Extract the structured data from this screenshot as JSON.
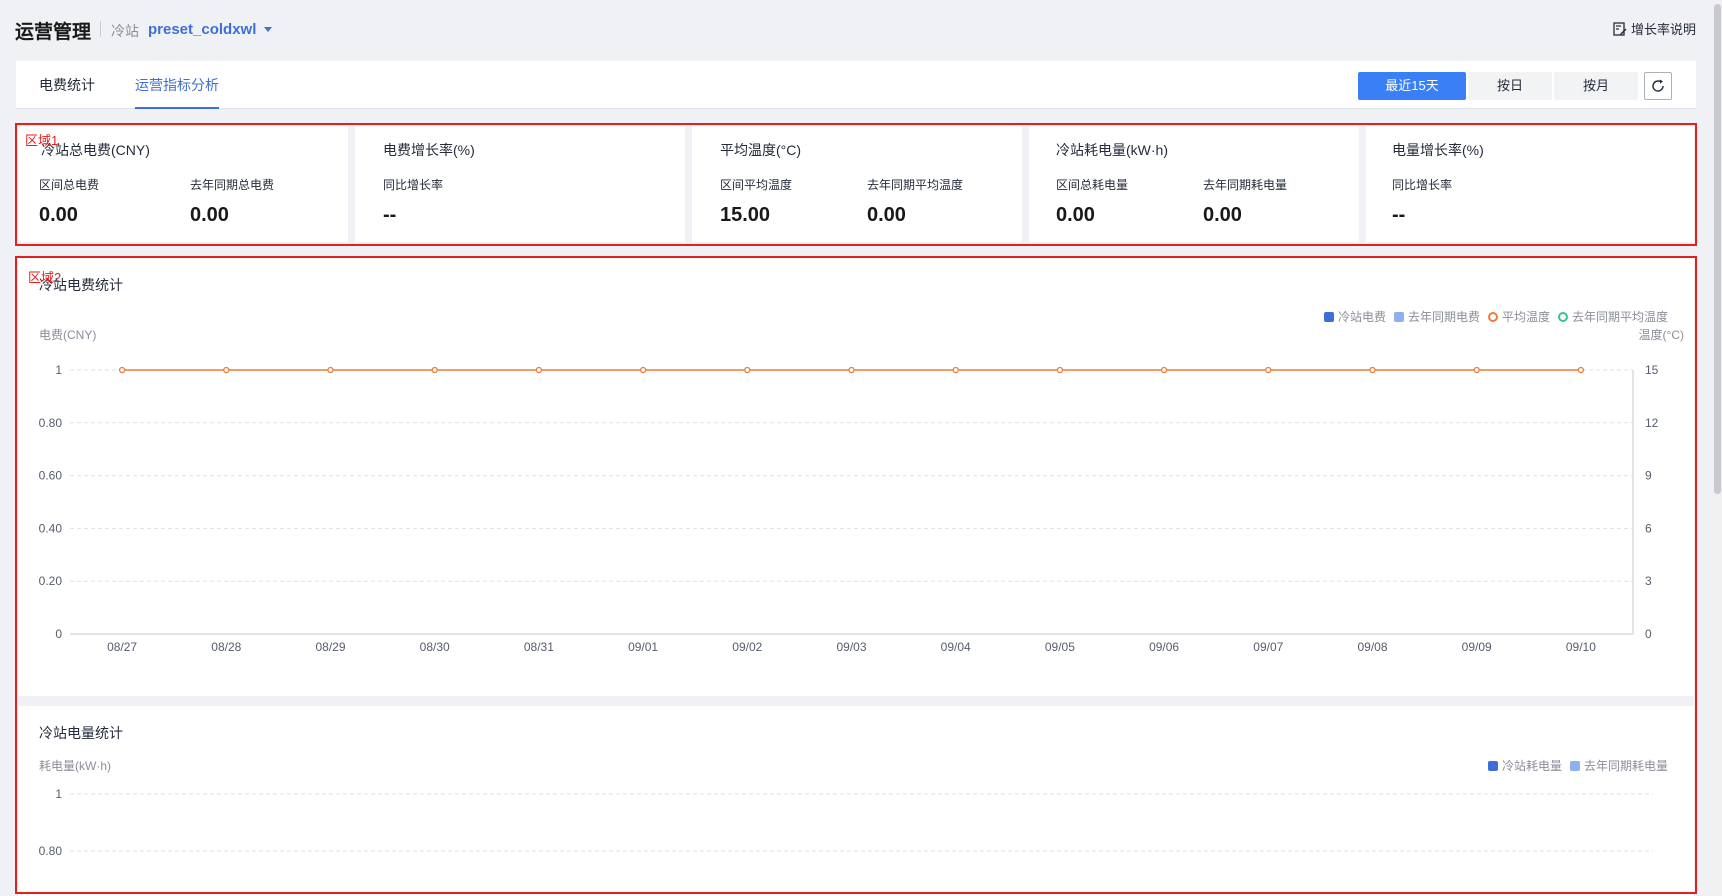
{
  "header": {
    "title": "运营管理",
    "station_label": "冷站",
    "station_name": "preset_coldxwl",
    "help_label": "增长率说明"
  },
  "tabs": [
    {
      "label": "电费统计",
      "active": false
    },
    {
      "label": "运营指标分析",
      "active": true
    }
  ],
  "range_buttons": [
    {
      "label": "最近15天",
      "active": true
    },
    {
      "label": "按日",
      "active": false
    },
    {
      "label": "按月",
      "active": false
    }
  ],
  "regions": {
    "r1": "区域1",
    "r2": "区域2"
  },
  "kpis": [
    {
      "title": "冷站总电费(CNY)",
      "items": [
        {
          "label": "区间总电费",
          "value": "0.00"
        },
        {
          "label": "去年同期总电费",
          "value": "0.00"
        }
      ]
    },
    {
      "title": "电费增长率(%)",
      "items": [
        {
          "label": "同比增长率",
          "value": "--"
        }
      ]
    },
    {
      "title": "平均温度(°C)",
      "items": [
        {
          "label": "区间平均温度",
          "value": "15.00"
        },
        {
          "label": "去年同期平均温度",
          "value": "0.00"
        }
      ]
    },
    {
      "title": "冷站耗电量(kW·h)",
      "items": [
        {
          "label": "区间总耗电量",
          "value": "0.00"
        },
        {
          "label": "去年同期耗电量",
          "value": "0.00"
        }
      ]
    },
    {
      "title": "电量增长率(%)",
      "items": [
        {
          "label": "同比增长率",
          "value": "--"
        }
      ]
    }
  ],
  "colors": {
    "accent": "#3a7ff5",
    "region_outline": "#e51e1e",
    "series_fee": "#3e6fd9",
    "series_fee_last": "#8fb0f0",
    "series_temp": "#f07a3c",
    "series_temp_last": "#3cc28e"
  },
  "chart_data": [
    {
      "type": "line",
      "title": "冷站电费统计",
      "ylabel": "电费(CNY)",
      "y2label": "温度(°C)",
      "legend_placement": "top-right",
      "grid": true,
      "x": [
        "08/27",
        "08/28",
        "08/29",
        "08/30",
        "08/31",
        "09/01",
        "09/02",
        "09/03",
        "09/04",
        "09/05",
        "09/06",
        "09/07",
        "09/08",
        "09/09",
        "09/10"
      ],
      "ylim": [
        0,
        1
      ],
      "yticks": [
        "0",
        "0.20",
        "0.40",
        "0.60",
        "0.80",
        "1"
      ],
      "y2lim": [
        0,
        15
      ],
      "y2ticks": [
        "0",
        "3",
        "6",
        "9",
        "12",
        "15"
      ],
      "series": [
        {
          "name": "冷站电费",
          "kind": "bar",
          "axis": "left",
          "values": [
            0,
            0,
            0,
            0,
            0,
            0,
            0,
            0,
            0,
            0,
            0,
            0,
            0,
            0,
            0
          ]
        },
        {
          "name": "去年同期电费",
          "kind": "bar",
          "axis": "left",
          "values": [
            0,
            0,
            0,
            0,
            0,
            0,
            0,
            0,
            0,
            0,
            0,
            0,
            0,
            0,
            0
          ]
        },
        {
          "name": "平均温度",
          "kind": "line",
          "axis": "right",
          "values": [
            15,
            15,
            15,
            15,
            15,
            15,
            15,
            15,
            15,
            15,
            15,
            15,
            15,
            15,
            15
          ]
        },
        {
          "name": "去年同期平均温度",
          "kind": "line",
          "axis": "right",
          "values": []
        }
      ]
    },
    {
      "type": "bar",
      "title": "冷站电量统计",
      "ylabel": "耗电量(kW·h)",
      "legend_placement": "top-right",
      "grid": true,
      "yticks_visible": [
        "1",
        "0.80"
      ],
      "ylim": [
        0,
        1
      ],
      "series": [
        {
          "name": "冷站耗电量",
          "values": []
        },
        {
          "name": "去年同期耗电量",
          "values": []
        }
      ]
    }
  ]
}
